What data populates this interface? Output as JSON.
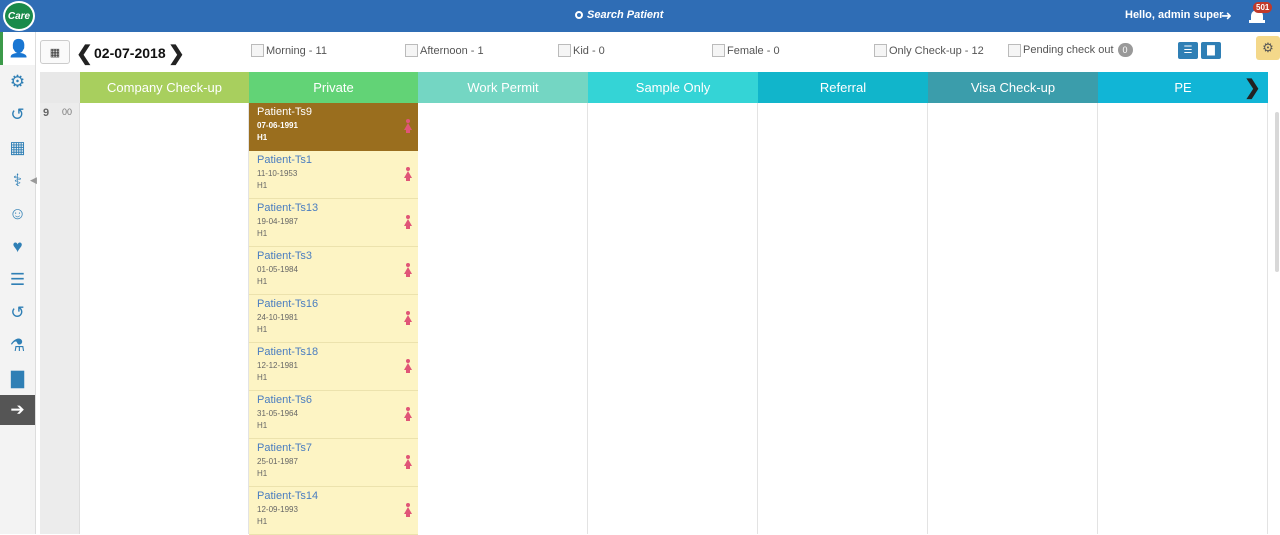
{
  "app": {
    "logo_text": "Care"
  },
  "topbar": {
    "search_label": "Search Patient",
    "greeting": "Hello, admin super",
    "notification_count": "501"
  },
  "toolbar": {
    "date": "02-07-2018",
    "filters": [
      {
        "label": "Morning - 11"
      },
      {
        "label": "Afternoon - 1"
      },
      {
        "label": "Kid - 0"
      },
      {
        "label": "Female - 0"
      },
      {
        "label": "Only Check-up - 12"
      },
      {
        "label": "Pending check out",
        "count": "0"
      }
    ]
  },
  "schedule": {
    "hour": "9",
    "minute": "00",
    "columns": [
      {
        "label": "Company Check-up",
        "color": "#a8cf5e"
      },
      {
        "label": "Private",
        "color": "#62d376"
      },
      {
        "label": "Work Permit",
        "color": "#74d6c3"
      },
      {
        "label": "Sample Only",
        "color": "#34d4d6"
      },
      {
        "label": "Referral",
        "color": "#11b5cb"
      },
      {
        "label": "Visa Check-up",
        "color": "#3b9dab"
      },
      {
        "label": "PE",
        "color": "#11b5d6"
      }
    ],
    "patients": [
      {
        "name": "Patient-Ts9",
        "dob": "07-06-1991",
        "room": "H1"
      },
      {
        "name": "Patient-Ts1",
        "dob": "11-10-1953",
        "room": "H1"
      },
      {
        "name": "Patient-Ts13",
        "dob": "19-04-1987",
        "room": "H1"
      },
      {
        "name": "Patient-Ts3",
        "dob": "01-05-1984",
        "room": "H1"
      },
      {
        "name": "Patient-Ts16",
        "dob": "24-10-1981",
        "room": "H1"
      },
      {
        "name": "Patient-Ts18",
        "dob": "12-12-1981",
        "room": "H1"
      },
      {
        "name": "Patient-Ts6",
        "dob": "31-05-1964",
        "room": "H1"
      },
      {
        "name": "Patient-Ts7",
        "dob": "25-01-1987",
        "room": "H1"
      },
      {
        "name": "Patient-Ts14",
        "dob": "12-09-1993",
        "room": "H1"
      }
    ]
  },
  "colors": {
    "topbar": "#2f6db5",
    "selected_card": "#9a6e1e",
    "card": "#fdf4c4",
    "female_icon": "#e05577"
  },
  "sidebar_icons": [
    "user-icon",
    "gear-icon",
    "history-icon",
    "calendar-icon",
    "stethoscope-icon",
    "doctor-icon",
    "heartbeat-icon",
    "list-icon",
    "history-icon",
    "flask-icon",
    "bar-chart-icon",
    "arrow-right-circle-icon"
  ]
}
